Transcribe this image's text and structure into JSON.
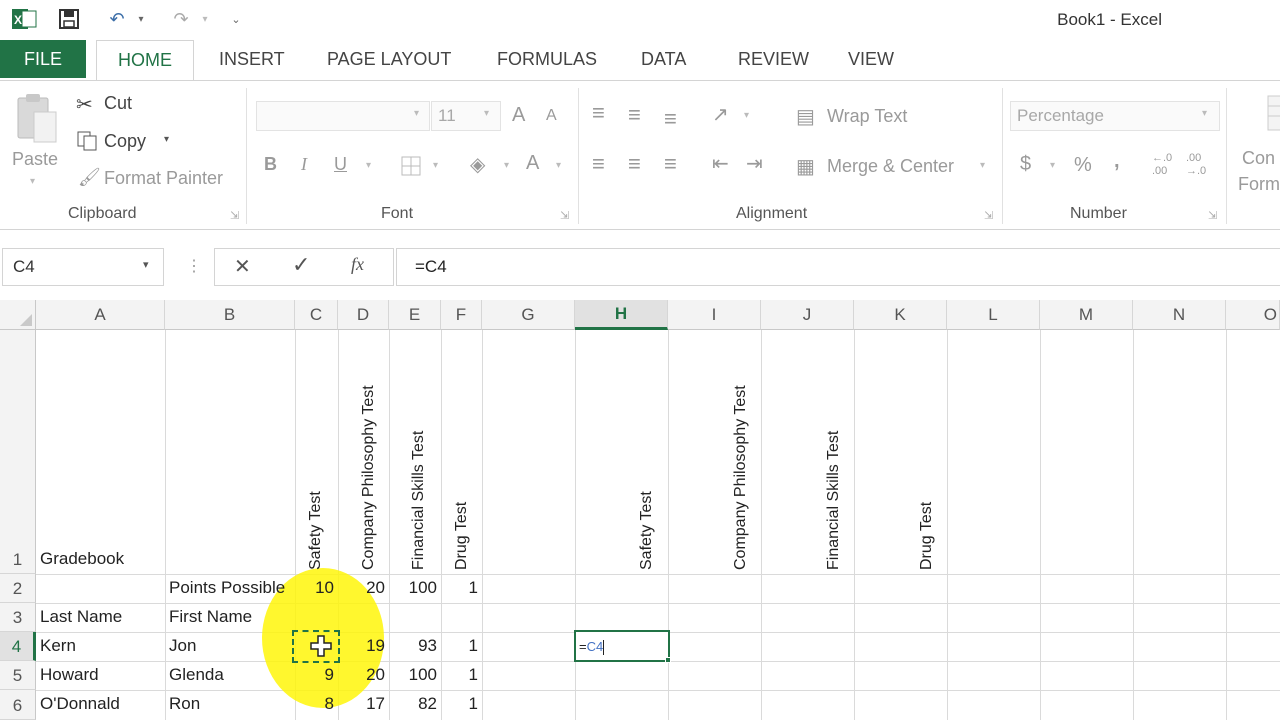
{
  "window": {
    "title": "Book1 - Excel"
  },
  "qat": {
    "excel_icon": "excel-logo-icon",
    "save_icon": "save-icon",
    "undo_icon": "undo-icon",
    "redo_icon": "redo-icon",
    "customize_icon": "chevron-down-icon"
  },
  "tabs": [
    "FILE",
    "HOME",
    "INSERT",
    "PAGE LAYOUT",
    "FORMULAS",
    "DATA",
    "REVIEW",
    "VIEW"
  ],
  "ribbon": {
    "clipboard": {
      "paste": "Paste",
      "cut": "Cut",
      "copy": "Copy",
      "format_painter": "Format Painter",
      "label": "Clipboard"
    },
    "font": {
      "font_size": "11",
      "label": "Font",
      "bold": "B",
      "italic": "I",
      "underline": "U",
      "grow": "A",
      "shrink": "A",
      "color": "A"
    },
    "alignment": {
      "wrap_text": "Wrap Text",
      "merge_center": "Merge & Center",
      "label": "Alignment"
    },
    "number": {
      "format": "Percentage",
      "currency": "$",
      "percent": "%",
      "comma": ",",
      "inc_dec": "←.0 .00",
      "dec_dec": ".00 →.0",
      "label": "Number"
    },
    "styles": {
      "conditional_line1": "Con",
      "conditional_line2": "Form"
    }
  },
  "formula_bar": {
    "name_box": "C4",
    "cancel": "✕",
    "enter": "✓",
    "fx": "fx",
    "formula": "=C4"
  },
  "columns": [
    "A",
    "B",
    "C",
    "D",
    "E",
    "F",
    "G",
    "H",
    "I",
    "J",
    "K",
    "L",
    "M",
    "N",
    "O"
  ],
  "rows": [
    "1",
    "2",
    "3",
    "4",
    "5",
    "6"
  ],
  "sheet": {
    "a1": "Gradebook",
    "headers_c_f": [
      "Safety Test",
      "Company Philosophy Test",
      "Financial Skills Test",
      "Drug Test"
    ],
    "headers_h_k": [
      "Safety Test",
      "Company Philosophy Test",
      "Financial Skills Test",
      "Drug Test"
    ],
    "b2": "Points Possible",
    "points": [
      "10",
      "20",
      "100",
      "1"
    ],
    "a3": "Last Name",
    "b3": "First Name",
    "students": [
      {
        "last": "Kern",
        "first": "Jon",
        "scores": [
          "",
          "19",
          "93",
          "1"
        ]
      },
      {
        "last": "Howard",
        "first": "Glenda",
        "scores": [
          "9",
          "20",
          "100",
          "1"
        ]
      },
      {
        "last": "O'Donnald",
        "first": "Ron",
        "scores": [
          "8",
          "17",
          "82",
          "1"
        ]
      }
    ],
    "h4_prefix": "=",
    "h4_ref": "C4"
  },
  "colors": {
    "accent": "#217346",
    "ref_blue": "#4472c4",
    "highlight": "#fff500"
  }
}
